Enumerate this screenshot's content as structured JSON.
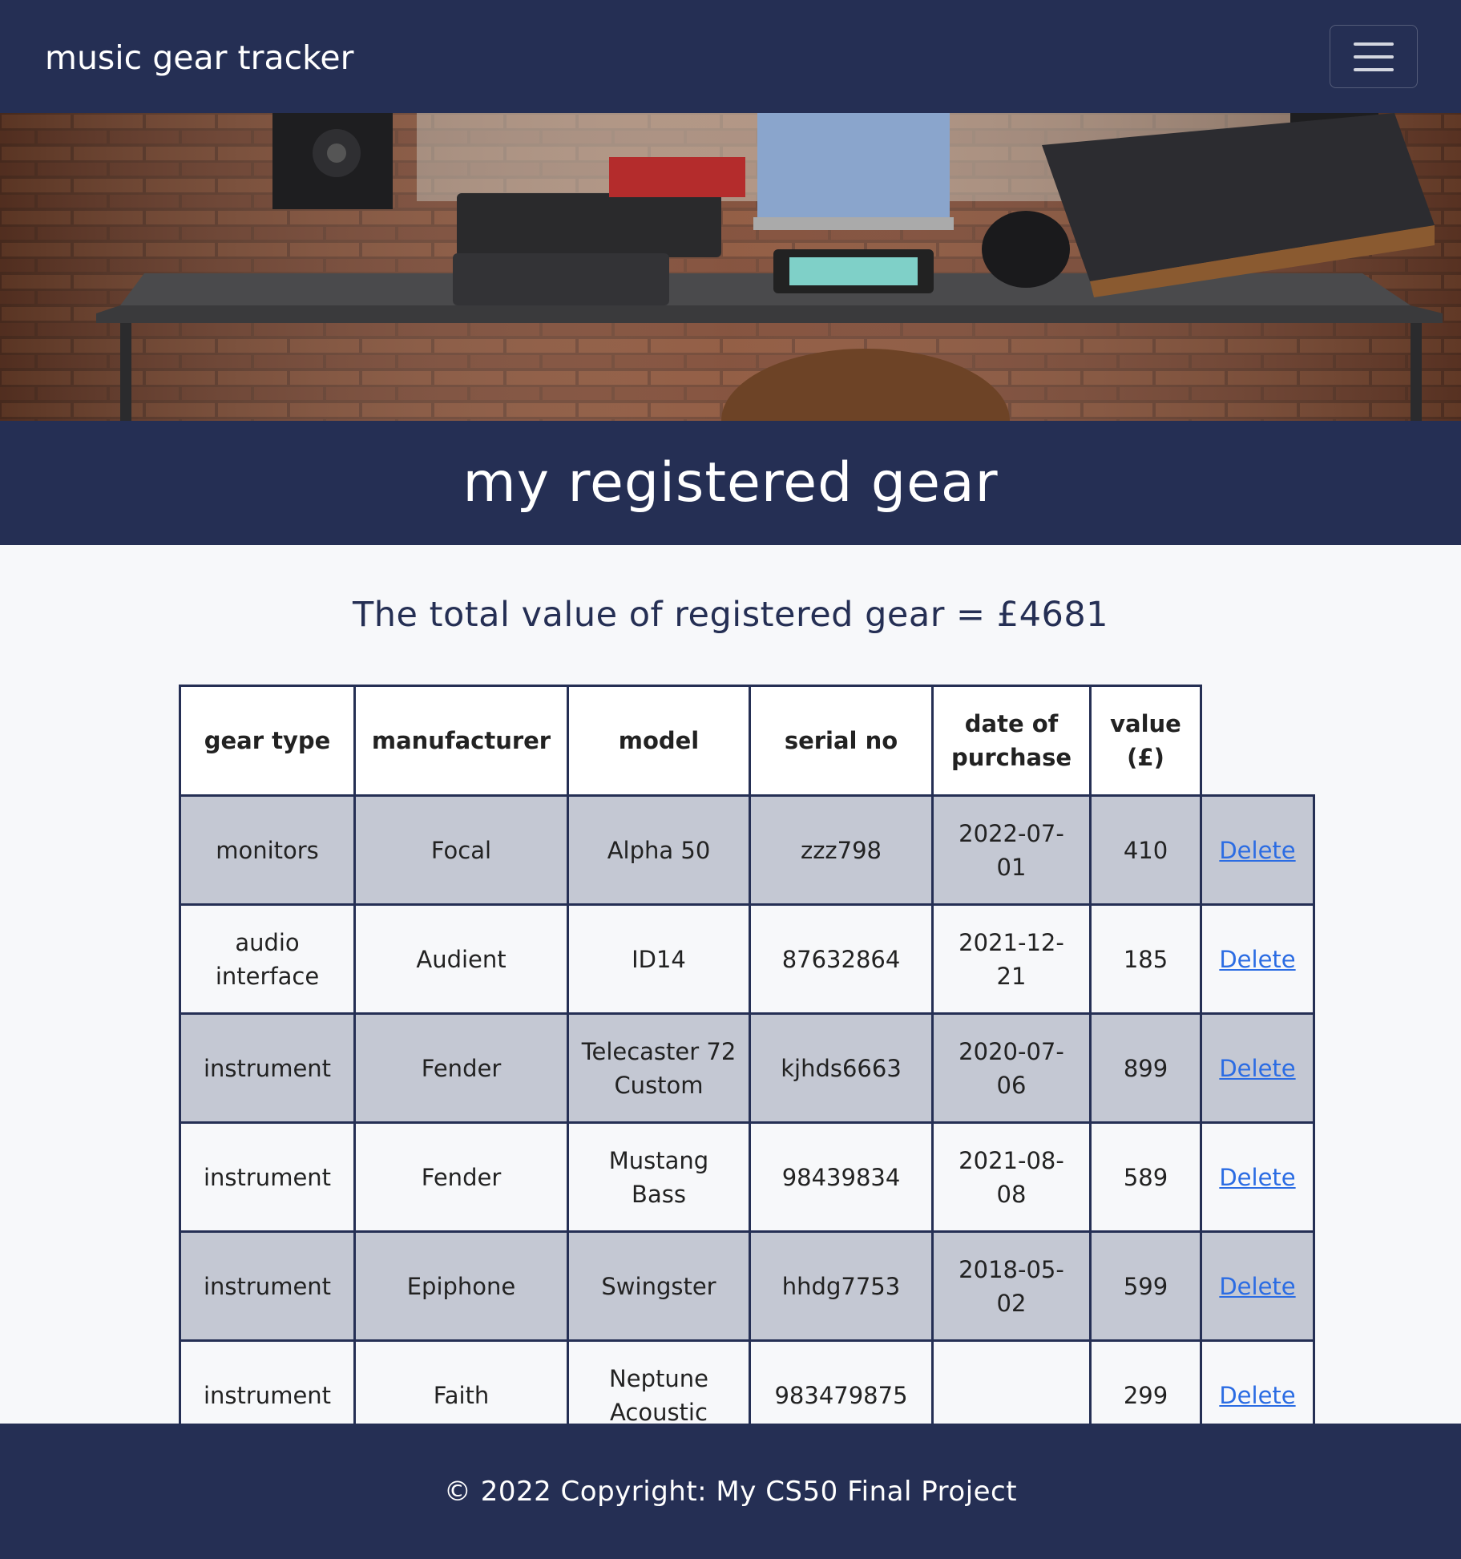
{
  "navbar": {
    "brand": "music gear tracker",
    "menu_icon": "hamburger-menu-icon"
  },
  "hero": {
    "image": "music studio desk with synthesizers, laptop, monitors and headphones"
  },
  "page_title": "my registered gear",
  "total_text": "The total value of registered gear = £4681",
  "table": {
    "headers": [
      "gear type",
      "manufacturer",
      "model",
      "serial no",
      "date of purchase",
      "value (£)"
    ],
    "rows": [
      {
        "gear_type": "monitors",
        "manufacturer": "Focal",
        "model": "Alpha 50",
        "serial": "zzz798",
        "date": "2022-07-01",
        "value": "410",
        "action": "Delete"
      },
      {
        "gear_type": "audio interface",
        "manufacturer": "Audient",
        "model": "ID14",
        "serial": "87632864",
        "date": "2021-12-21",
        "value": "185",
        "action": "Delete"
      },
      {
        "gear_type": "instrument",
        "manufacturer": "Fender",
        "model": "Telecaster 72 Custom",
        "serial": "kjhds6663",
        "date": "2020-07-06",
        "value": "899",
        "action": "Delete"
      },
      {
        "gear_type": "instrument",
        "manufacturer": "Fender",
        "model": "Mustang Bass",
        "serial": "98439834",
        "date": "2021-08-08",
        "value": "589",
        "action": "Delete"
      },
      {
        "gear_type": "instrument",
        "manufacturer": "Epiphone",
        "model": "Swingster",
        "serial": "hhdg7753",
        "date": "2018-05-02",
        "value": "599",
        "action": "Delete"
      },
      {
        "gear_type": "instrument",
        "manufacturer": "Faith",
        "model": "Neptune Acoustic",
        "serial": "983479875",
        "date": "",
        "value": "299",
        "action": "Delete"
      }
    ]
  },
  "footer": {
    "text": "© 2022 Copyright: My CS50 Final Project"
  },
  "colors": {
    "navy": "#252f54",
    "row_shade": "#c4c8d3",
    "link": "#2b6ce3"
  }
}
